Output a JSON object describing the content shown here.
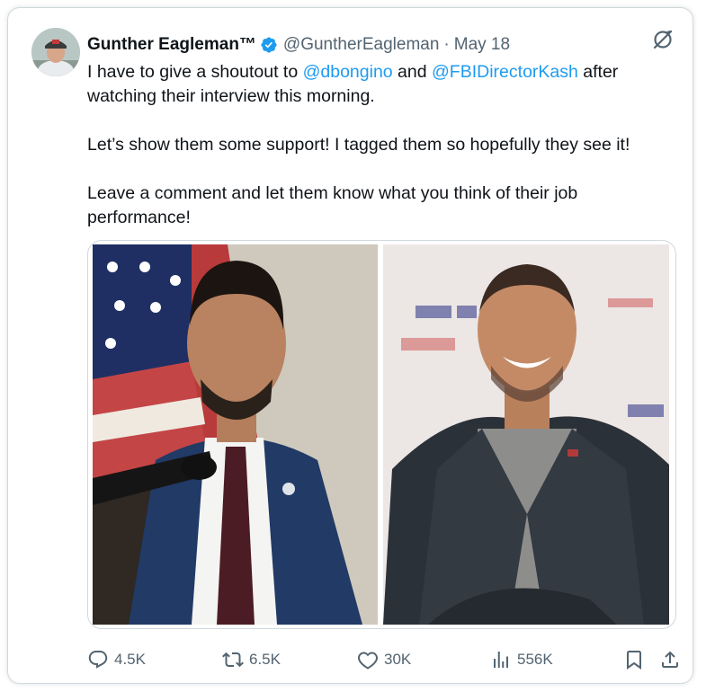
{
  "author": {
    "name": "Gunther Eagleman™",
    "handle": "@GuntherEagleman",
    "separator": "·",
    "date": "May 18"
  },
  "post": {
    "line1_pre": "I have to give a shoutout to ",
    "mention1": "@dbongino",
    "line1_mid": " and ",
    "mention2": "@FBIDirectorKash",
    "line1_post": " after watching their interview this morning.",
    "paragraph2": "Let’s show them some support! I tagged them so hopefully they see it!",
    "paragraph3": "Leave a comment and let them know what you think of their job performance!"
  },
  "media": {
    "photo_left": "kash-patel-at-podium-photo",
    "photo_right": "dan-bongino-smiling-photo"
  },
  "metrics": {
    "replies": "4.5K",
    "reposts": "6.5K",
    "likes": "30K",
    "views": "556K"
  },
  "icons": {
    "verified": "verified-badge-icon",
    "grok": "grok-icon",
    "reply": "reply-icon",
    "repost": "repost-icon",
    "like": "heart-icon",
    "views": "views-icon",
    "bookmark": "bookmark-icon",
    "share": "share-icon"
  },
  "colors": {
    "link": "#1d9bf0",
    "text": "#0f1419",
    "muted": "#536471",
    "border": "#cfd9de"
  }
}
